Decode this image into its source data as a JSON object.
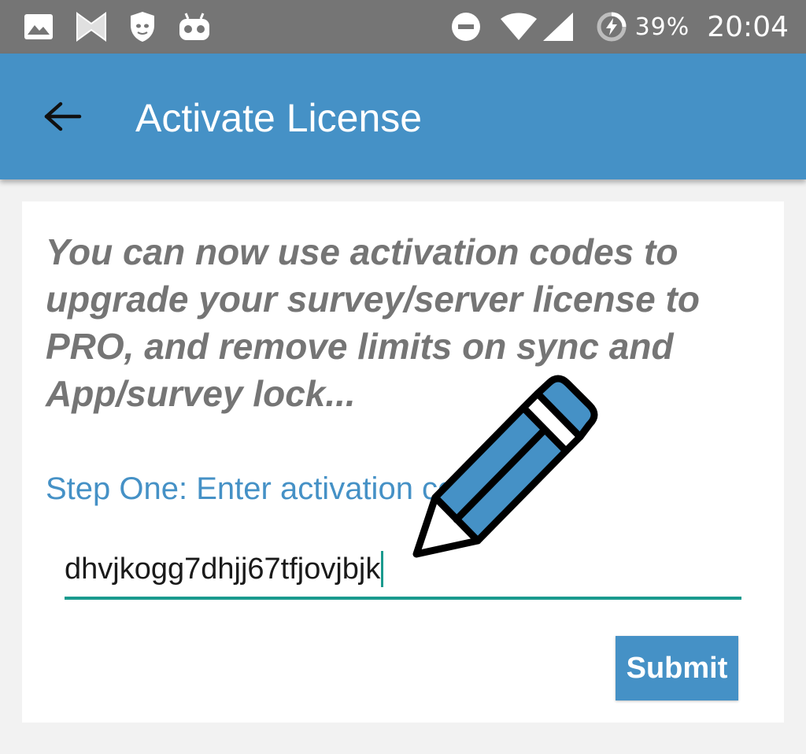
{
  "status_bar": {
    "icons_left": [
      "image-icon",
      "bowtie-icon",
      "shield-icon",
      "robot-icon"
    ],
    "icons_right": [
      "dnd-icon",
      "wifi-icon",
      "cell-signal-icon",
      "battery-charging-icon"
    ],
    "battery_percent": "39%",
    "time": "20:04"
  },
  "app_bar": {
    "back_icon": "arrow-left-icon",
    "title": "Activate License"
  },
  "card": {
    "intro_text": "You can now use activation codes to upgrade your survey/server license to PRO, and remove limits on sync and App/survey lock...",
    "step_label": "Step One: Enter activation code",
    "code_field": {
      "value": "dhvjkogg7dhjj67tfjovjbjk"
    },
    "submit_label": "Submit"
  },
  "overlay": {
    "icon": "pencil-icon"
  },
  "colors": {
    "status_bar": "#757575",
    "app_bar": "#4591c6",
    "accent_teal": "#1a9a8e",
    "intro_text": "#757575",
    "background": "#f2f2f2",
    "card": "#ffffff"
  }
}
